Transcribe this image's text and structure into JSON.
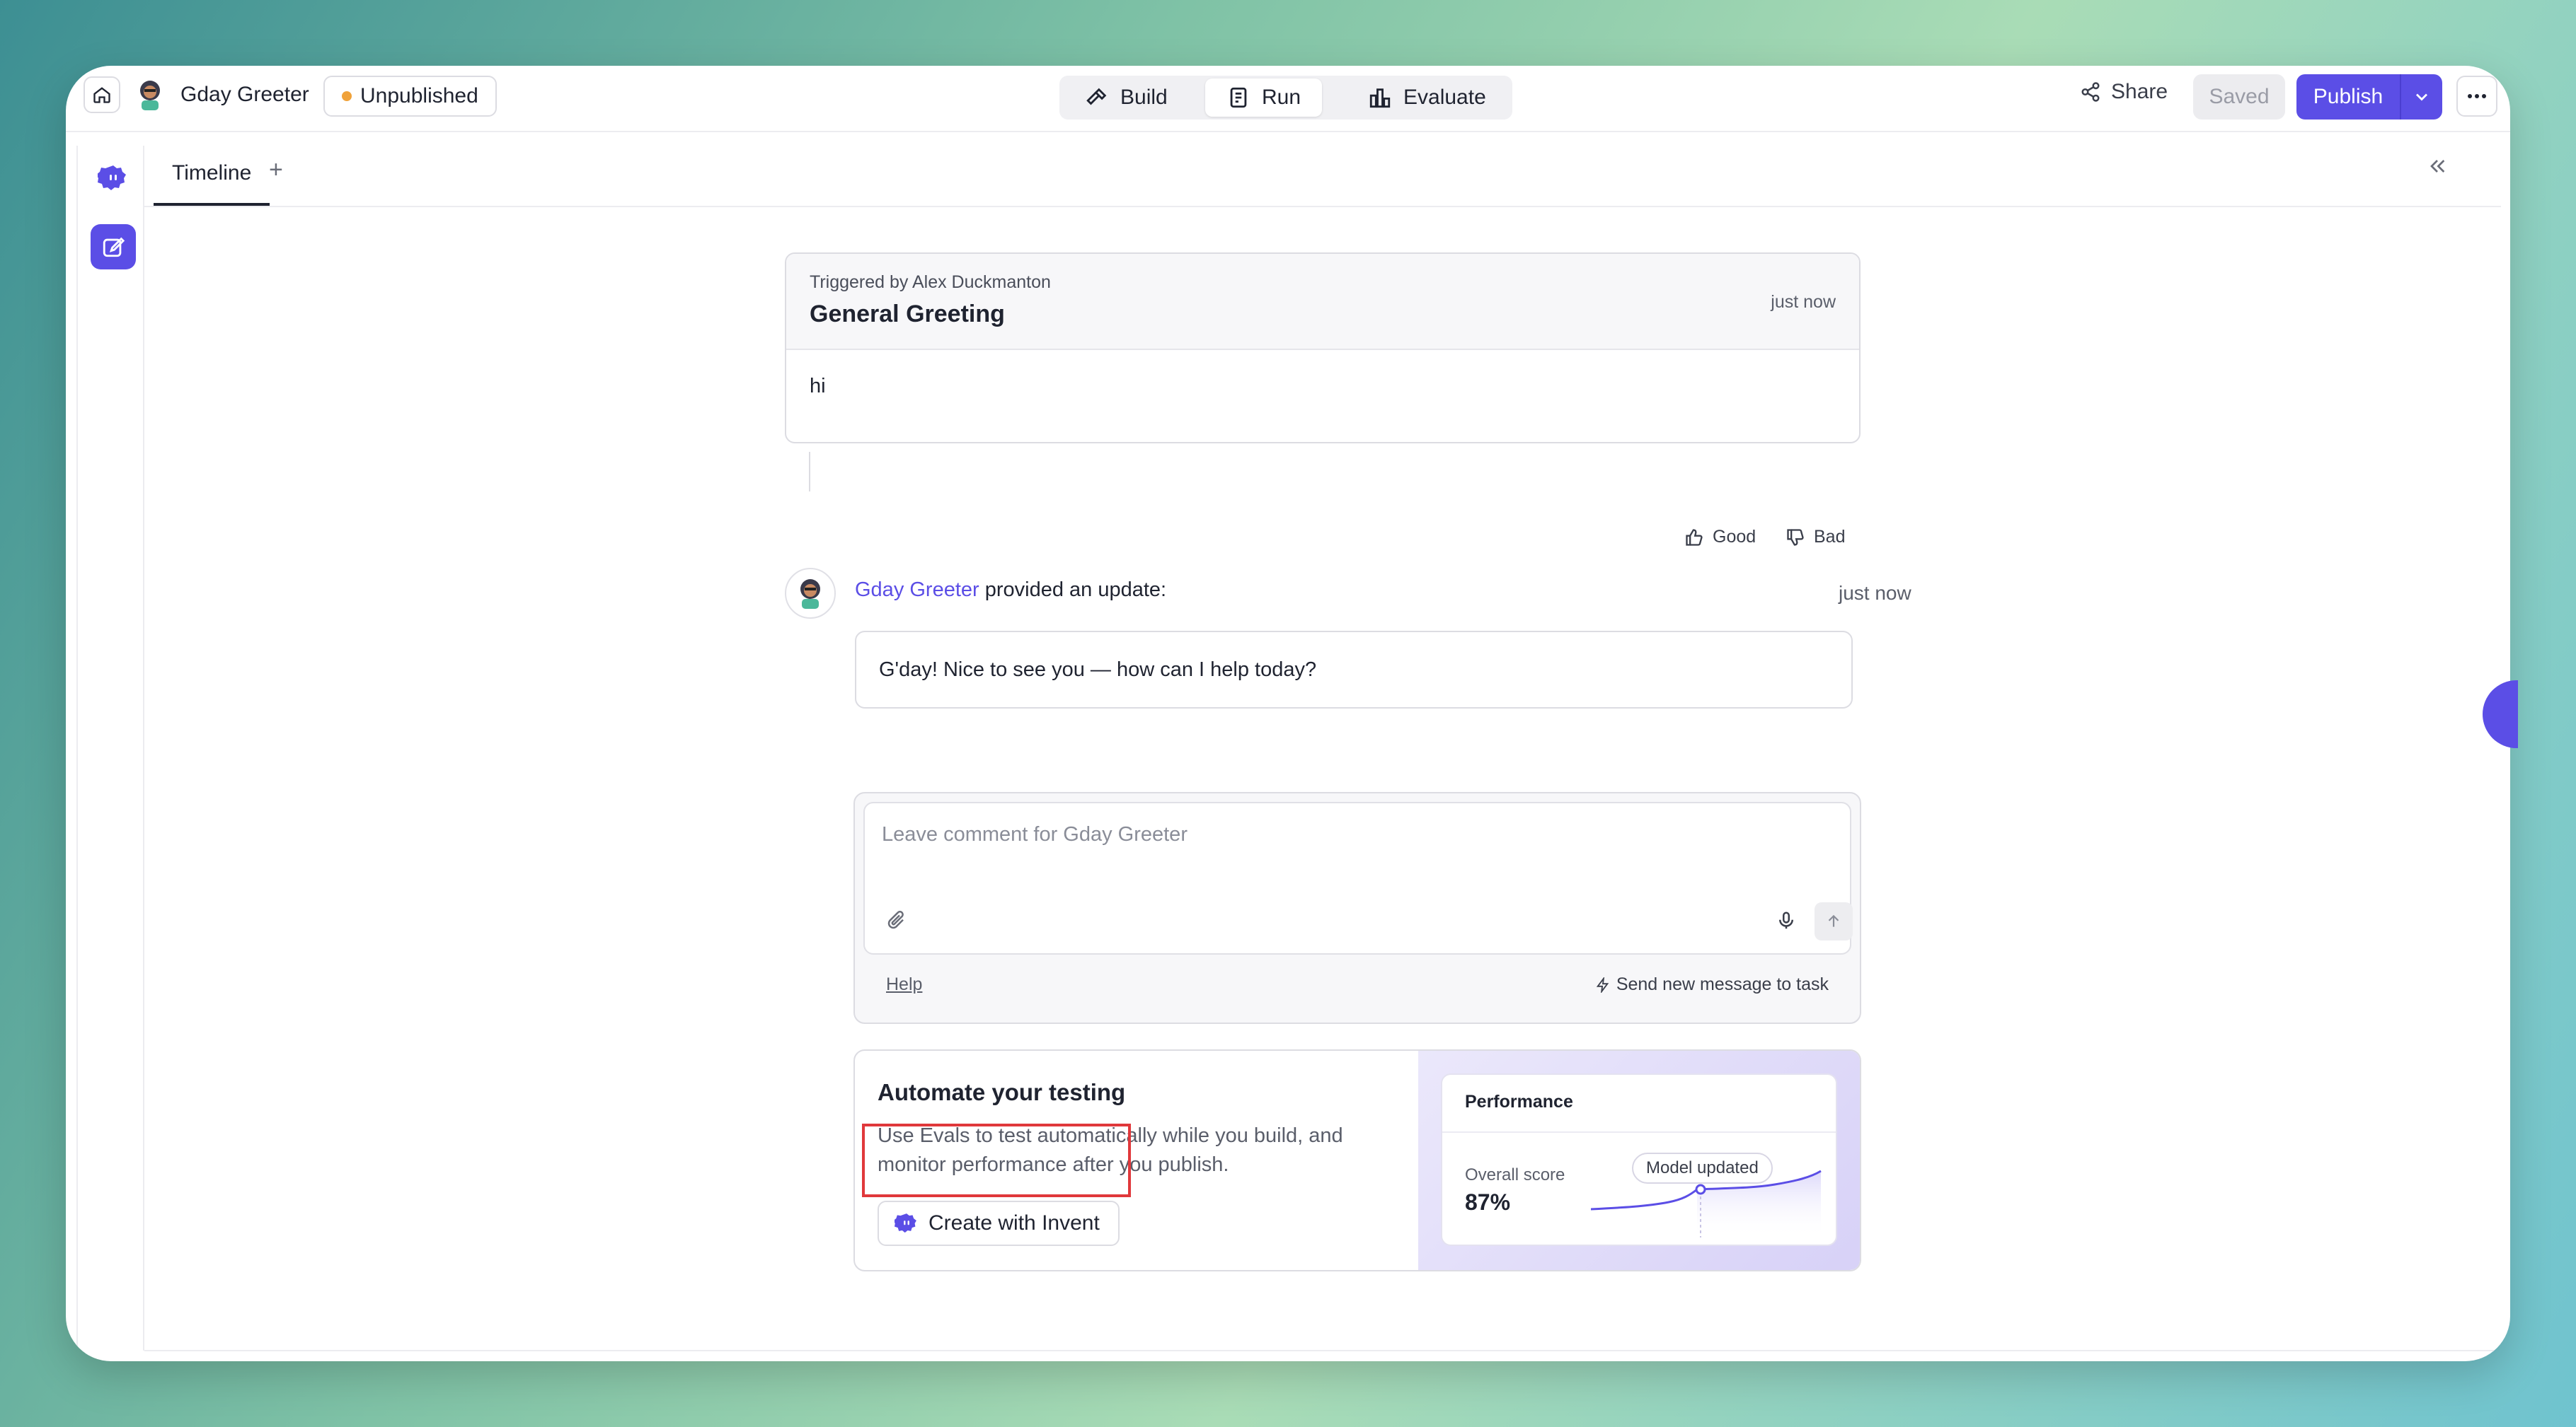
{
  "topbar": {
    "app_name": "Gday Greeter",
    "status": "Unpublished",
    "status_color": "#f0a23a",
    "modes": [
      "Build",
      "Run",
      "Evaluate"
    ],
    "active_mode": "Run",
    "share": "Share",
    "saved": "Saved",
    "publish": "Publish",
    "accent": "#5b4ee6"
  },
  "tabs": {
    "items": [
      "Timeline"
    ],
    "add": "+"
  },
  "trigger": {
    "subtitle": "Triggered by Alex Duckmanton",
    "title": "General Greeting",
    "time": "just now",
    "message": "hi"
  },
  "feedback": {
    "good": "Good",
    "bad": "Bad"
  },
  "update": {
    "agent": "Gday Greeter",
    "text": " provided an update:",
    "time": "just now",
    "reply": "G'day! Nice to see you — how can I help today?"
  },
  "comment": {
    "placeholder": "Leave comment for Gday Greeter",
    "help": "Help",
    "send_new": "Send new message to task"
  },
  "promo": {
    "title": "Automate your testing",
    "description": "Use Evals to test automatically while you build, and monitor performance after you publish.",
    "button": "Create with Invent",
    "card_title": "Performance",
    "score_label": "Overall score",
    "score": "87%",
    "pill": "Model updated"
  },
  "icons": [
    "home-icon",
    "agent-avatar-icon",
    "hammer-icon",
    "run-icon",
    "chart-icon",
    "share-icon",
    "chevron-down-icon",
    "more-icon",
    "invent-icon",
    "edit-icon",
    "sidebar-toggle-icon",
    "collapse-icon",
    "thumbs-up-icon",
    "thumbs-down-icon",
    "paperclip-icon",
    "mic-icon",
    "arrow-up-icon",
    "lightning-icon"
  ]
}
